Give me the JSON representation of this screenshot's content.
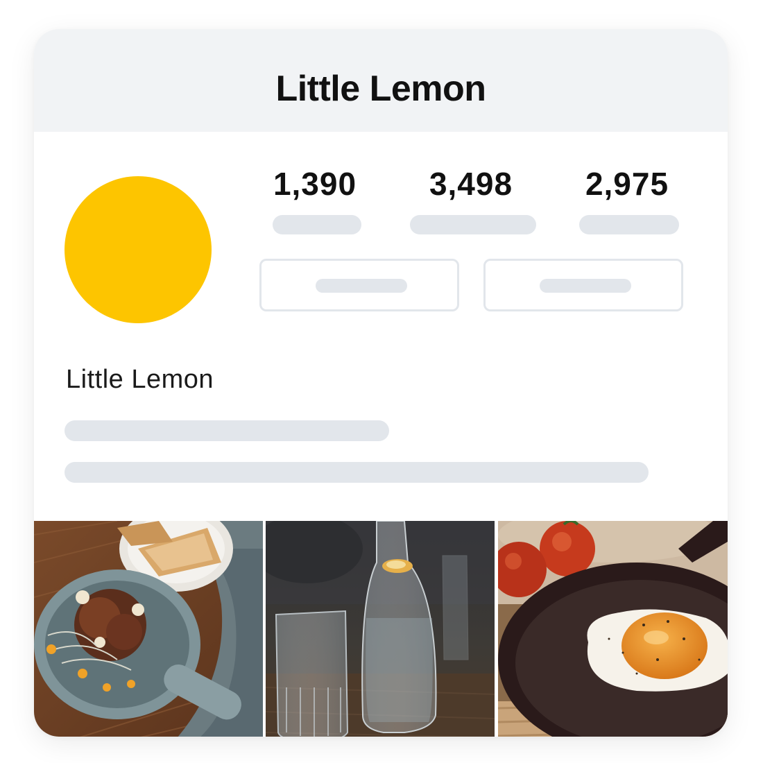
{
  "header": {
    "title": "Little Lemon"
  },
  "profile": {
    "name": "Little Lemon",
    "avatar_color": "#FDC500"
  },
  "stats": [
    {
      "value": "1,390"
    },
    {
      "value": "3,498"
    },
    {
      "value": "2,975"
    }
  ],
  "colors": {
    "header_bg": "#F1F3F5",
    "placeholder": "#E2E6EB",
    "button_border": "#E2E6EB"
  },
  "grid": {
    "photos": [
      {
        "icon": "pan-with-food-and-toast-photo"
      },
      {
        "icon": "water-carafe-and-glass-photo"
      },
      {
        "icon": "fried-egg-in-pan-with-tomatoes-photo"
      }
    ]
  }
}
